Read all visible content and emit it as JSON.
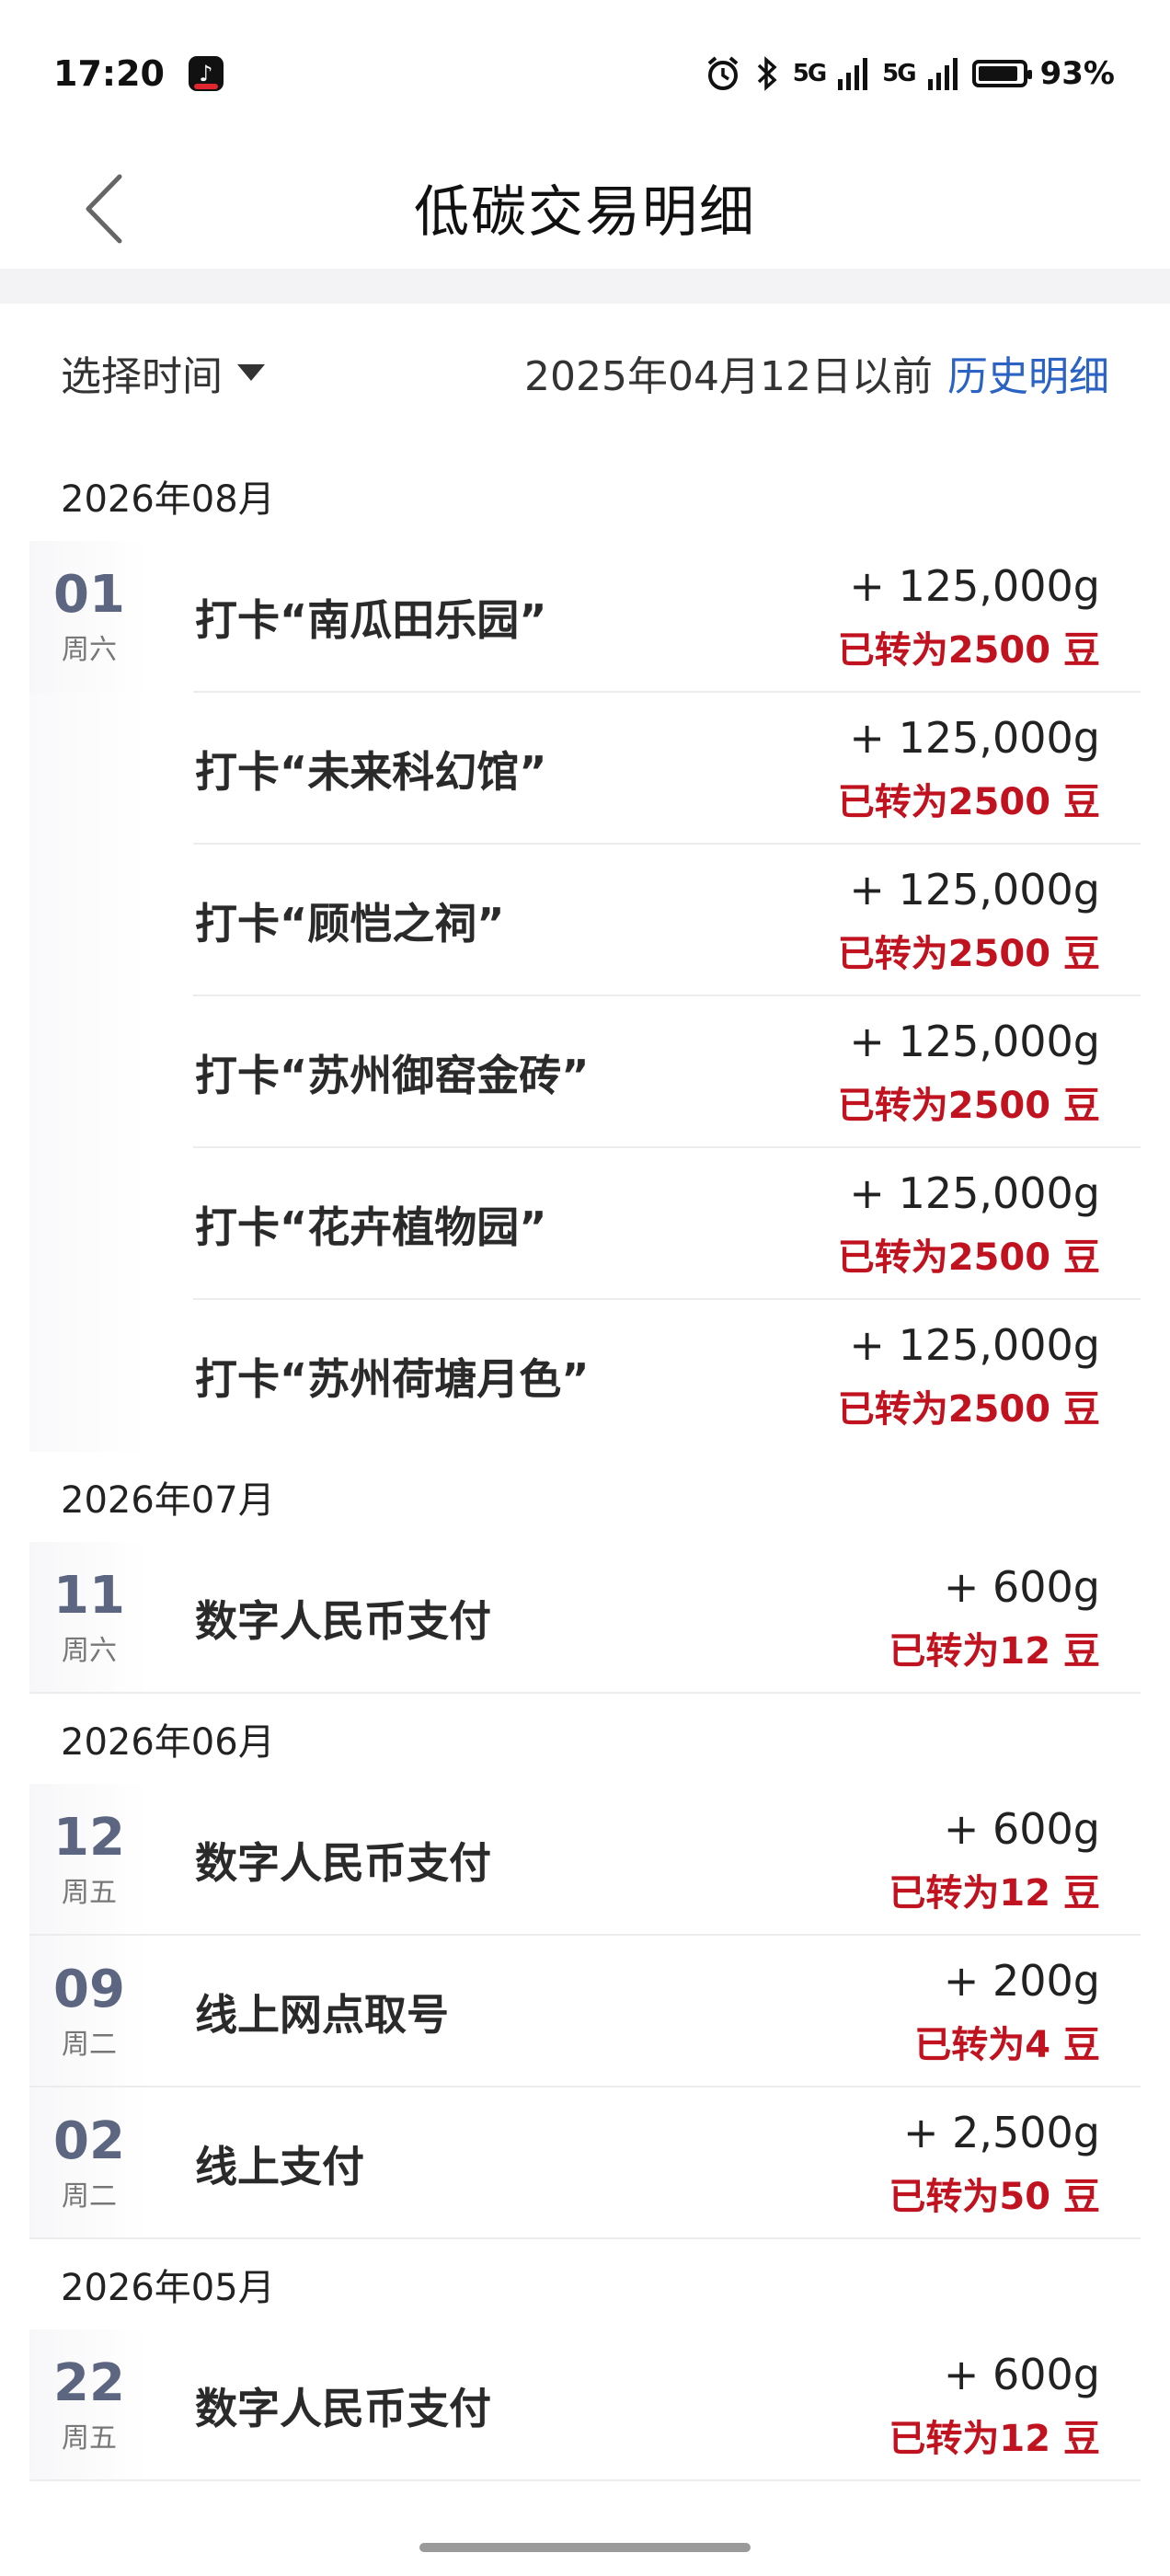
{
  "status_bar": {
    "time": "17:20",
    "app_icon": "tiktok-icon",
    "network_1": "5G",
    "network_2": "5G",
    "battery": "93%",
    "battery_level": 0.93
  },
  "nav": {
    "title": "低碳交易明细",
    "back_icon": "chevron-left-icon"
  },
  "filter": {
    "time_select_label": "选择时间",
    "before_date_text": "2025年04月12日以前",
    "history_link": "历史明细"
  },
  "sections": [
    {
      "month": "2026年08月",
      "rows": [
        {
          "day": "01",
          "weekday": "周六",
          "title": "打卡“南瓜田乐园”",
          "amount": "+ 125,000g",
          "converted": "已转为2500 豆"
        },
        {
          "day": "",
          "weekday": "",
          "title": "打卡“未来科幻馆”",
          "amount": "+ 125,000g",
          "converted": "已转为2500 豆"
        },
        {
          "day": "",
          "weekday": "",
          "title": "打卡“顾恺之祠”",
          "amount": "+ 125,000g",
          "converted": "已转为2500 豆"
        },
        {
          "day": "",
          "weekday": "",
          "title": "打卡“苏州御窑金砖”",
          "amount": "+ 125,000g",
          "converted": "已转为2500 豆"
        },
        {
          "day": "",
          "weekday": "",
          "title": "打卡“花卉植物园”",
          "amount": "+ 125,000g",
          "converted": "已转为2500 豆"
        },
        {
          "day": "",
          "weekday": "",
          "title": "打卡“苏州荷塘月色”",
          "amount": "+ 125,000g",
          "converted": "已转为2500 豆"
        }
      ]
    },
    {
      "month": "2026年07月",
      "rows": [
        {
          "day": "11",
          "weekday": "周六",
          "title": "数字人民币支付",
          "amount": "+ 600g",
          "converted": "已转为12 豆"
        }
      ]
    },
    {
      "month": "2026年06月",
      "rows": [
        {
          "day": "12",
          "weekday": "周五",
          "title": "数字人民币支付",
          "amount": "+ 600g",
          "converted": "已转为12 豆"
        },
        {
          "day": "09",
          "weekday": "周二",
          "title": "线上网点取号",
          "amount": "+ 200g",
          "converted": "已转为4 豆"
        },
        {
          "day": "02",
          "weekday": "周二",
          "title": "线上支付",
          "amount": "+ 2,500g",
          "converted": "已转为50 豆"
        }
      ]
    },
    {
      "month": "2026年05月",
      "rows": [
        {
          "day": "22",
          "weekday": "周五",
          "title": "数字人民币支付",
          "amount": "+ 600g",
          "converted": "已转为12 豆"
        }
      ]
    }
  ]
}
